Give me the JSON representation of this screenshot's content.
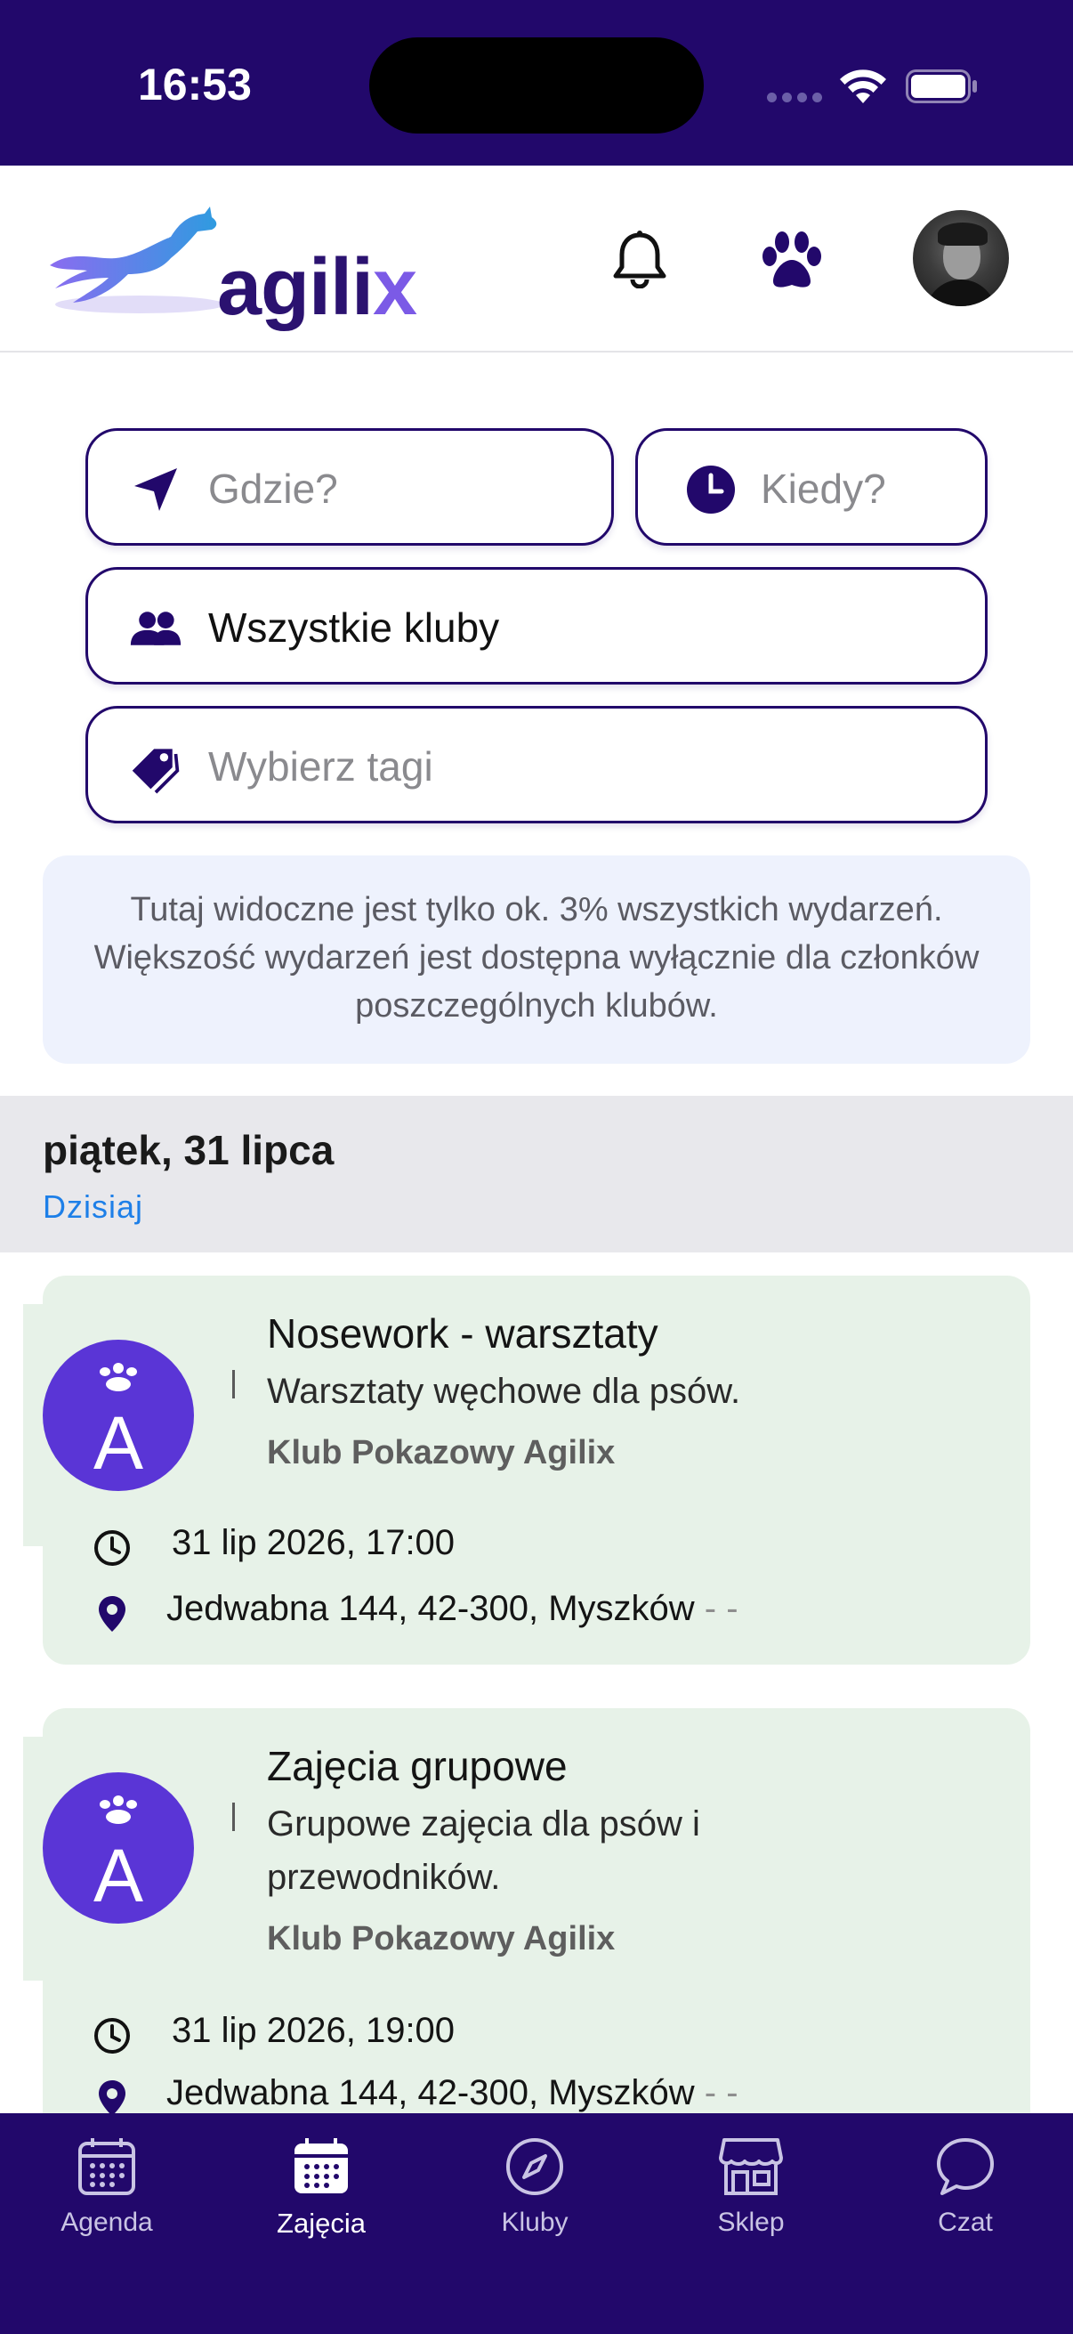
{
  "status_bar": {
    "time": "16:53"
  },
  "header": {
    "logo_text": "agili",
    "logo_text_accent": "x"
  },
  "filters": {
    "where_placeholder": "Gdzie?",
    "when_placeholder": "Kiedy?",
    "clubs_value": "Wszystkie kluby",
    "tags_placeholder": "Wybierz tagi"
  },
  "info_text": "Tutaj widoczne jest tylko ok. 3% wszystkich wydarzeń. Większość wydarzeń jest dostępna wyłącznie dla członków poszczególnych klubów.",
  "date_section": {
    "title": "piątek, 31 lipca",
    "subtitle": "Dzisiaj"
  },
  "events": [
    {
      "logo_letter": "A",
      "title": "Nosework - warsztaty",
      "description": "Warsztaty węchowe dla psów.",
      "club": "Klub Pokazowy Agilix",
      "datetime": "31 lip 2026, 17:00",
      "address": "Jedwabna 144, 42-300, Myszków",
      "address_suffix": "- -"
    },
    {
      "logo_letter": "A",
      "title": "Zajęcia grupowe",
      "description": "Grupowe zajęcia dla psów i przewodników.",
      "club": "Klub Pokazowy Agilix",
      "datetime": "31 lip 2026, 19:00",
      "address": "Jedwabna 144, 42-300, Myszków",
      "address_suffix": "- -"
    }
  ],
  "tab_bar": {
    "items": [
      {
        "label": "Agenda",
        "icon": "calendar-icon",
        "active": false
      },
      {
        "label": "Zajęcia",
        "icon": "calendar-filled-icon",
        "active": true
      },
      {
        "label": "Kluby",
        "icon": "compass-icon",
        "active": false
      },
      {
        "label": "Sklep",
        "icon": "store-icon",
        "active": false
      },
      {
        "label": "Czat",
        "icon": "chat-bubble-icon",
        "active": false
      }
    ]
  },
  "colors": {
    "brand": "#22086b",
    "accent": "#5a35d6",
    "card_bg": "#e7f2e8",
    "info_bg": "#eef2fd",
    "link": "#1d7fe8"
  }
}
